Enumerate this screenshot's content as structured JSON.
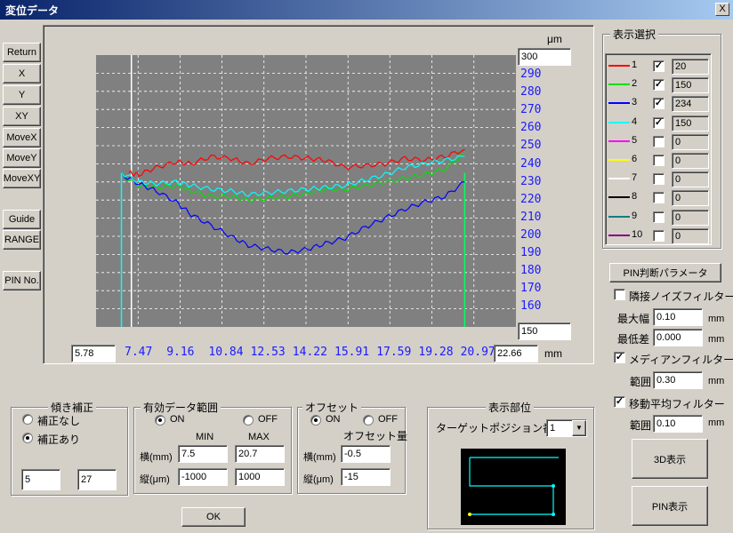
{
  "window": {
    "title": "変位データ",
    "close_glyph": "X"
  },
  "left_buttons": [
    "Return",
    "X",
    "Y",
    "XY",
    "MoveX",
    "MoveY",
    "MoveXY",
    "Guide",
    "RANGE",
    "PIN No."
  ],
  "chart": {
    "y_unit": "μm",
    "y_max_field": "300",
    "y_min_field": "150",
    "y_ticks": [
      "290",
      "280",
      "270",
      "260",
      "250",
      "240",
      "230",
      "220",
      "210",
      "200",
      "190",
      "180",
      "170",
      "160"
    ],
    "x_min_field": "5.78",
    "x_max_field": "22.66",
    "x_ticks": [
      "7.47",
      "9.16",
      "10.84",
      "12.53",
      "14.22",
      "15.91",
      "17.59",
      "19.28",
      "20.97"
    ],
    "x_unit": "mm"
  },
  "chart_data": {
    "type": "line",
    "xlabel": "mm",
    "ylabel": "μm",
    "xlim": [
      5.78,
      22.66
    ],
    "ylim": [
      150,
      300
    ],
    "grid": true,
    "series": [
      {
        "name": "1",
        "color": "#ff0000",
        "x": [
          7.1,
          7.5,
          8.2,
          9.0,
          9.6,
          10.4,
          11.2,
          11.9,
          12.7,
          13.5,
          14.3,
          15.0,
          15.8,
          16.6,
          17.4,
          18.2,
          19.0,
          19.8,
          20.6
        ],
        "y": [
          235,
          234,
          238,
          241,
          240,
          244,
          243,
          240,
          243,
          244,
          243,
          242,
          238,
          239,
          240,
          243,
          242,
          244,
          248
        ]
      },
      {
        "name": "2",
        "color": "#00e000",
        "x": [
          6.8,
          7.5,
          8.2,
          9.0,
          9.6,
          10.4,
          11.2,
          11.9,
          12.7,
          13.5,
          14.3,
          15.0,
          15.8,
          16.6,
          17.4,
          18.2,
          19.0,
          19.8,
          20.6
        ],
        "y": [
          234,
          228,
          227,
          228,
          225,
          222,
          222,
          220,
          221,
          222,
          224,
          226,
          226,
          228,
          230,
          232,
          234,
          237,
          246
        ]
      },
      {
        "name": "3",
        "color": "#0000ff",
        "x": [
          6.8,
          7.5,
          8.2,
          9.0,
          9.6,
          10.4,
          11.2,
          11.9,
          12.7,
          13.5,
          14.3,
          15.0,
          15.8,
          16.6,
          17.4,
          18.2,
          19.0,
          19.8,
          20.6
        ],
        "y": [
          234,
          229,
          225,
          219,
          212,
          206,
          200,
          195,
          193,
          191,
          193,
          196,
          199,
          205,
          210,
          215,
          219,
          222,
          230
        ]
      },
      {
        "name": "4",
        "color": "#00ffff",
        "x": [
          6.8,
          7.5,
          8.2,
          9.0,
          9.6,
          10.4,
          11.2,
          11.9,
          12.7,
          13.5,
          14.3,
          15.0,
          15.8,
          16.6,
          17.4,
          18.2,
          19.0,
          19.8,
          20.6
        ],
        "y": [
          235,
          230,
          229,
          230,
          228,
          226,
          225,
          223,
          224,
          225,
          226,
          227,
          228,
          231,
          234,
          238,
          240,
          242,
          244
        ]
      }
    ],
    "vertical_markers": [
      {
        "x": 6.8,
        "color": "#00ffff"
      },
      {
        "x": 20.6,
        "color": "#00ff66"
      },
      {
        "x": 7.2,
        "color": "#ffffff"
      }
    ]
  },
  "display_select": {
    "title": "表示選択",
    "rows": [
      {
        "num": "1",
        "color": "#ff0000",
        "checked": true,
        "value": "20"
      },
      {
        "num": "2",
        "color": "#00e000",
        "checked": true,
        "value": "150"
      },
      {
        "num": "3",
        "color": "#0000ff",
        "checked": true,
        "value": "234"
      },
      {
        "num": "4",
        "color": "#00ffff",
        "checked": true,
        "value": "150"
      },
      {
        "num": "5",
        "color": "#ff00ff",
        "checked": false,
        "value": "0"
      },
      {
        "num": "6",
        "color": "#ffff00",
        "checked": false,
        "value": "0"
      },
      {
        "num": "7",
        "color": "#ffffff",
        "checked": false,
        "value": "0"
      },
      {
        "num": "8",
        "color": "#000000",
        "checked": false,
        "value": "0"
      },
      {
        "num": "9",
        "color": "#008080",
        "checked": false,
        "value": "0"
      },
      {
        "num": "10",
        "color": "#800080",
        "checked": false,
        "value": "0"
      }
    ]
  },
  "pin_params_button": "PIN判断パラメータ",
  "noise_filter": {
    "label": "隣接ノイズフィルター",
    "checked": false
  },
  "max_width": {
    "label": "最大幅",
    "value": "0.10",
    "unit": "mm"
  },
  "min_diff": {
    "label": "最低差",
    "value": "0.000",
    "unit": "mm"
  },
  "median_filter": {
    "label": "メディアンフィルター",
    "checked": true,
    "range_label": "範囲",
    "value": "0.30",
    "unit": "mm"
  },
  "moving_avg": {
    "label": "移動平均フィルター",
    "checked": true,
    "range_label": "範囲",
    "value": "0.10",
    "unit": "mm"
  },
  "btn_3d": "3D表示",
  "btn_pin": "PIN表示",
  "tilt": {
    "title": "傾き補正",
    "opt_none": "補正なし",
    "opt_with": "補正あり",
    "selected": "with",
    "val1": "5",
    "val2": "27"
  },
  "valid_range": {
    "title": "有効データ範囲",
    "on": "ON",
    "off": "OFF",
    "selected": "on",
    "min_label": "MIN",
    "max_label": "MAX",
    "row1_label": "横(mm)",
    "row2_label": "縦(μm)",
    "h_min": "7.5",
    "h_max": "20.7",
    "v_min": "-1000",
    "v_max": "1000"
  },
  "offset": {
    "title": "オフセット",
    "on": "ON",
    "off": "OFF",
    "selected": "on",
    "amount_label": "オフセット量",
    "row1_label": "横(mm)",
    "row2_label": "縦(μm)",
    "h": "-0.5",
    "v": "-15"
  },
  "display_part": {
    "title": "表示部位",
    "target_label": "ターゲットポジション番号",
    "target_value": "1"
  },
  "ok_button": "OK"
}
